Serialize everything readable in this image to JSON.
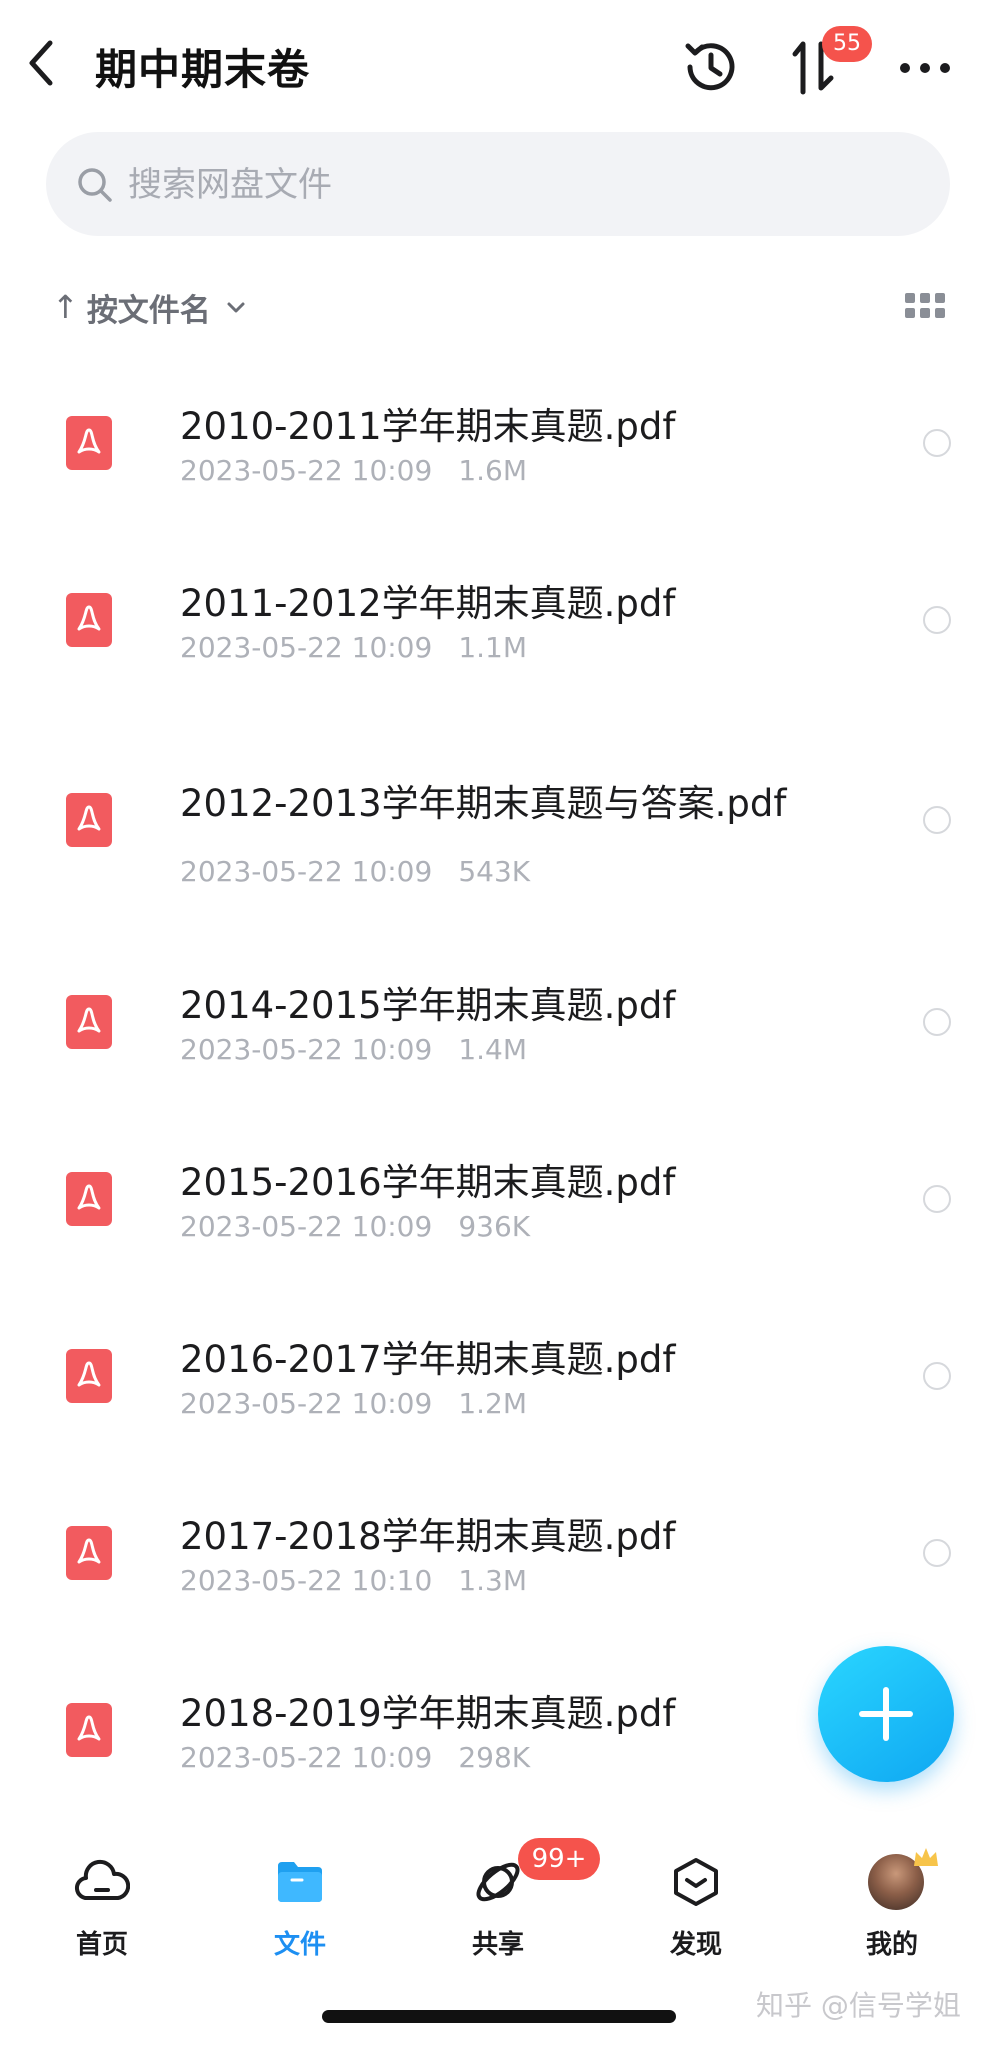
{
  "header": {
    "title": "期中期末卷",
    "transfer_badge": "55",
    "back_icon": "chevron-left-icon",
    "history_icon": "history-clock-icon",
    "transfer_icon": "transfer-arrows-icon",
    "more_icon": "more-dots-icon"
  },
  "search": {
    "placeholder": "搜索网盘文件",
    "value": ""
  },
  "sort": {
    "arrow": "↑",
    "label": "按文件名"
  },
  "files": [
    {
      "name": "2010-2011学年期末真题.pdf",
      "date": "2023-05-22 10:09",
      "size": "1.6M"
    },
    {
      "name": "2011-2012学年期末真题.pdf",
      "date": "2023-05-22 10:09",
      "size": "1.1M"
    },
    {
      "name": "2012-2013学年期末真题与答案.pdf",
      "date": "2023-05-22 10:09",
      "size": "543K"
    },
    {
      "name": "2014-2015学年期末真题.pdf",
      "date": "2023-05-22 10:09",
      "size": "1.4M"
    },
    {
      "name": "2015-2016学年期末真题.pdf",
      "date": "2023-05-22 10:09",
      "size": "936K"
    },
    {
      "name": "2016-2017学年期末真题.pdf",
      "date": "2023-05-22 10:09",
      "size": "1.2M"
    },
    {
      "name": "2017-2018学年期末真题.pdf",
      "date": "2023-05-22 10:10",
      "size": "1.3M"
    },
    {
      "name": "2018-2019学年期末真题.pdf",
      "date": "2023-05-22 10:09",
      "size": "298K"
    }
  ],
  "tabbar": {
    "items": [
      {
        "label": "首页",
        "icon": "cloud-icon"
      },
      {
        "label": "文件",
        "icon": "folder-icon"
      },
      {
        "label": "共享",
        "icon": "orbit-icon"
      },
      {
        "label": "发现",
        "icon": "cube-icon"
      },
      {
        "label": "我的",
        "icon": "avatar"
      }
    ],
    "share_badge": "99+"
  },
  "watermark": "知乎 @信号学姐",
  "colors": {
    "accent": "#1d8ff2",
    "badge": "#f5534c",
    "pdf": "#f25b5f",
    "fab": "#16b4f5"
  }
}
